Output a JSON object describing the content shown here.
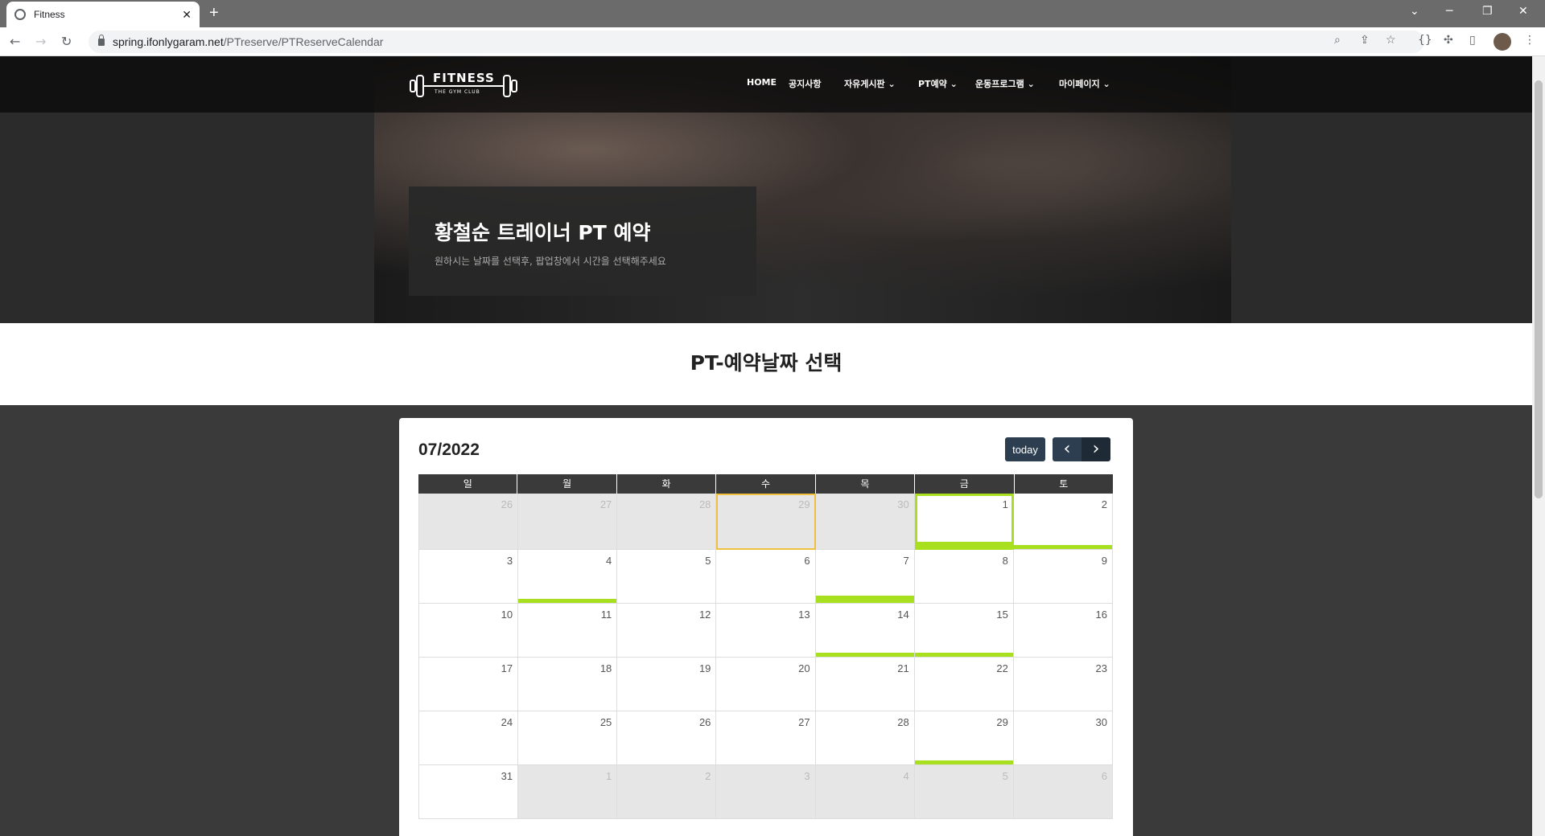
{
  "browser": {
    "tab_title": "Fitness",
    "tab_close": "✕",
    "new_tab": "+",
    "url_host": "spring.ifonlygaram.net",
    "url_path": "/PTreserve/PTReserveCalendar"
  },
  "site": {
    "logo_text": "FITNESS",
    "logo_sub": "THE GYM CLUB",
    "nav": [
      {
        "label": "HOME",
        "dropdown": false
      },
      {
        "label": "공지사항",
        "dropdown": false
      },
      {
        "label": "자유게시판",
        "dropdown": true
      },
      {
        "label": "PT예약",
        "dropdown": true
      },
      {
        "label": "운동프로그램",
        "dropdown": true
      },
      {
        "label": "마이페이지",
        "dropdown": true
      }
    ],
    "hero_title": "황철순 트레이너 PT 예약",
    "hero_subtitle": "원하시는 날짜를 선택후, 팝업창에서 시간을 선택해주세요",
    "section_title": "PT-예약날짜 선택"
  },
  "calendar": {
    "month_label": "07/2022",
    "today_label": "today",
    "prev_icon": "‹",
    "next_icon": "›",
    "days_of_week": [
      "일",
      "월",
      "화",
      "수",
      "목",
      "금",
      "토"
    ],
    "weeks": [
      [
        {
          "d": "26",
          "other": true
        },
        {
          "d": "27",
          "other": true
        },
        {
          "d": "28",
          "other": true
        },
        {
          "d": "29",
          "other": true,
          "today": true
        },
        {
          "d": "30",
          "other": true
        },
        {
          "d": "1",
          "selected": true,
          "bar": "thick"
        },
        {
          "d": "2",
          "bar": "thin"
        }
      ],
      [
        {
          "d": "3"
        },
        {
          "d": "4",
          "bar": "thin"
        },
        {
          "d": "5"
        },
        {
          "d": "6"
        },
        {
          "d": "7",
          "bar": "thick"
        },
        {
          "d": "8"
        },
        {
          "d": "9"
        }
      ],
      [
        {
          "d": "10"
        },
        {
          "d": "11"
        },
        {
          "d": "12"
        },
        {
          "d": "13"
        },
        {
          "d": "14",
          "bar": "thin"
        },
        {
          "d": "15",
          "bar": "thin"
        },
        {
          "d": "16"
        }
      ],
      [
        {
          "d": "17"
        },
        {
          "d": "18"
        },
        {
          "d": "19"
        },
        {
          "d": "20"
        },
        {
          "d": "21"
        },
        {
          "d": "22"
        },
        {
          "d": "23"
        }
      ],
      [
        {
          "d": "24"
        },
        {
          "d": "25"
        },
        {
          "d": "26"
        },
        {
          "d": "27"
        },
        {
          "d": "28"
        },
        {
          "d": "29",
          "bar": "thin"
        },
        {
          "d": "30"
        }
      ],
      [
        {
          "d": "31"
        },
        {
          "d": "1",
          "other": true
        },
        {
          "d": "2",
          "other": true
        },
        {
          "d": "3",
          "other": true
        },
        {
          "d": "4",
          "other": true
        },
        {
          "d": "5",
          "other": true
        },
        {
          "d": "6",
          "other": true
        }
      ]
    ],
    "event_color": "#a8e020",
    "today_color": "#f0c040"
  }
}
